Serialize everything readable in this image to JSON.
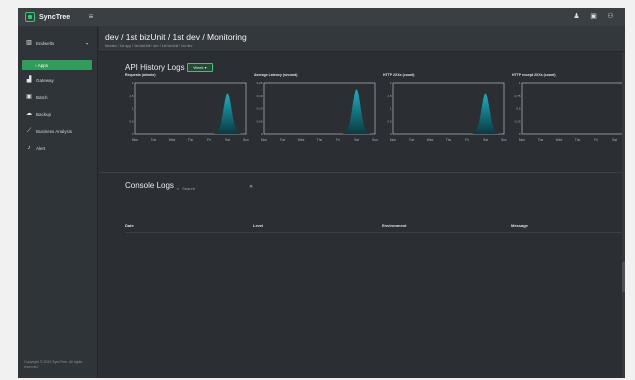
{
  "app": {
    "name": "SyncTree"
  },
  "sidebar": {
    "items": [
      {
        "label": "Endwelts",
        "icon": "bars-chart-icon"
      },
      {
        "label": "Apps",
        "icon": "chevron-right-icon"
      },
      {
        "label": "Gateway",
        "icon": "gateway-icon"
      },
      {
        "label": "Batch",
        "icon": "batch-icon"
      },
      {
        "label": "Backup",
        "icon": "cloud-icon"
      },
      {
        "label": "Business Analysis",
        "icon": "trend-icon"
      },
      {
        "label": "Alert",
        "icon": "bell-icon"
      }
    ],
    "footer": "Copyright © 2019 SyncTree. All rights reserved."
  },
  "header": {
    "title": "dev / 1st bizUnit / 1st dev / Monitoring",
    "breadcrumb": "Monitor / 1st app / 1st bizUnit / dev / 1st bizUnit / 1st dev"
  },
  "api_logs": {
    "title": "API History Logs",
    "range_label": "Week ▾"
  },
  "chart_data": [
    {
      "type": "area",
      "title": "Requests (minute)",
      "x": [
        "Mon",
        "Tue",
        "Wed",
        "Thu",
        "Fri",
        "Sat",
        "Sun"
      ],
      "values": [
        0,
        0,
        0,
        0,
        0,
        1.6,
        0
      ],
      "ylim": [
        0,
        2
      ],
      "grid": false
    },
    {
      "type": "area",
      "title": "Average Latency (second)",
      "x": [
        "Mon",
        "Tue",
        "Wed",
        "Thu",
        "Fri",
        "Sat",
        "Sun"
      ],
      "values": [
        0,
        0,
        0,
        0,
        0,
        0.22,
        0
      ],
      "ylim": [
        0,
        0.25
      ],
      "grid": false
    },
    {
      "type": "area",
      "title": "HTTP 2XXs (count)",
      "x": [
        "Mon",
        "Tue",
        "Wed",
        "Thu",
        "Fri",
        "Sat",
        "Sun"
      ],
      "values": [
        0,
        0,
        0,
        0,
        0,
        1.6,
        0
      ],
      "ylim": [
        0,
        2
      ],
      "grid": false
    },
    {
      "type": "area",
      "title": "HTTP except 2XXs (count)",
      "x": [
        "Mon",
        "Tue",
        "Wed",
        "Thu",
        "Fri",
        "Sat",
        "Sun"
      ],
      "values": [
        0,
        0,
        0,
        0,
        0,
        0,
        0
      ],
      "ylim": [
        0,
        1
      ],
      "grid": false
    }
  ],
  "console": {
    "title": "Console Logs",
    "search_placeholder": "Search",
    "clear_glyph": "✕",
    "columns": [
      "Date",
      "Level",
      "Environment",
      "Message"
    ]
  },
  "colors": {
    "accent": "#2ecc71",
    "area_top": "#1ab0c2",
    "area_bottom": "#0b3a41"
  }
}
